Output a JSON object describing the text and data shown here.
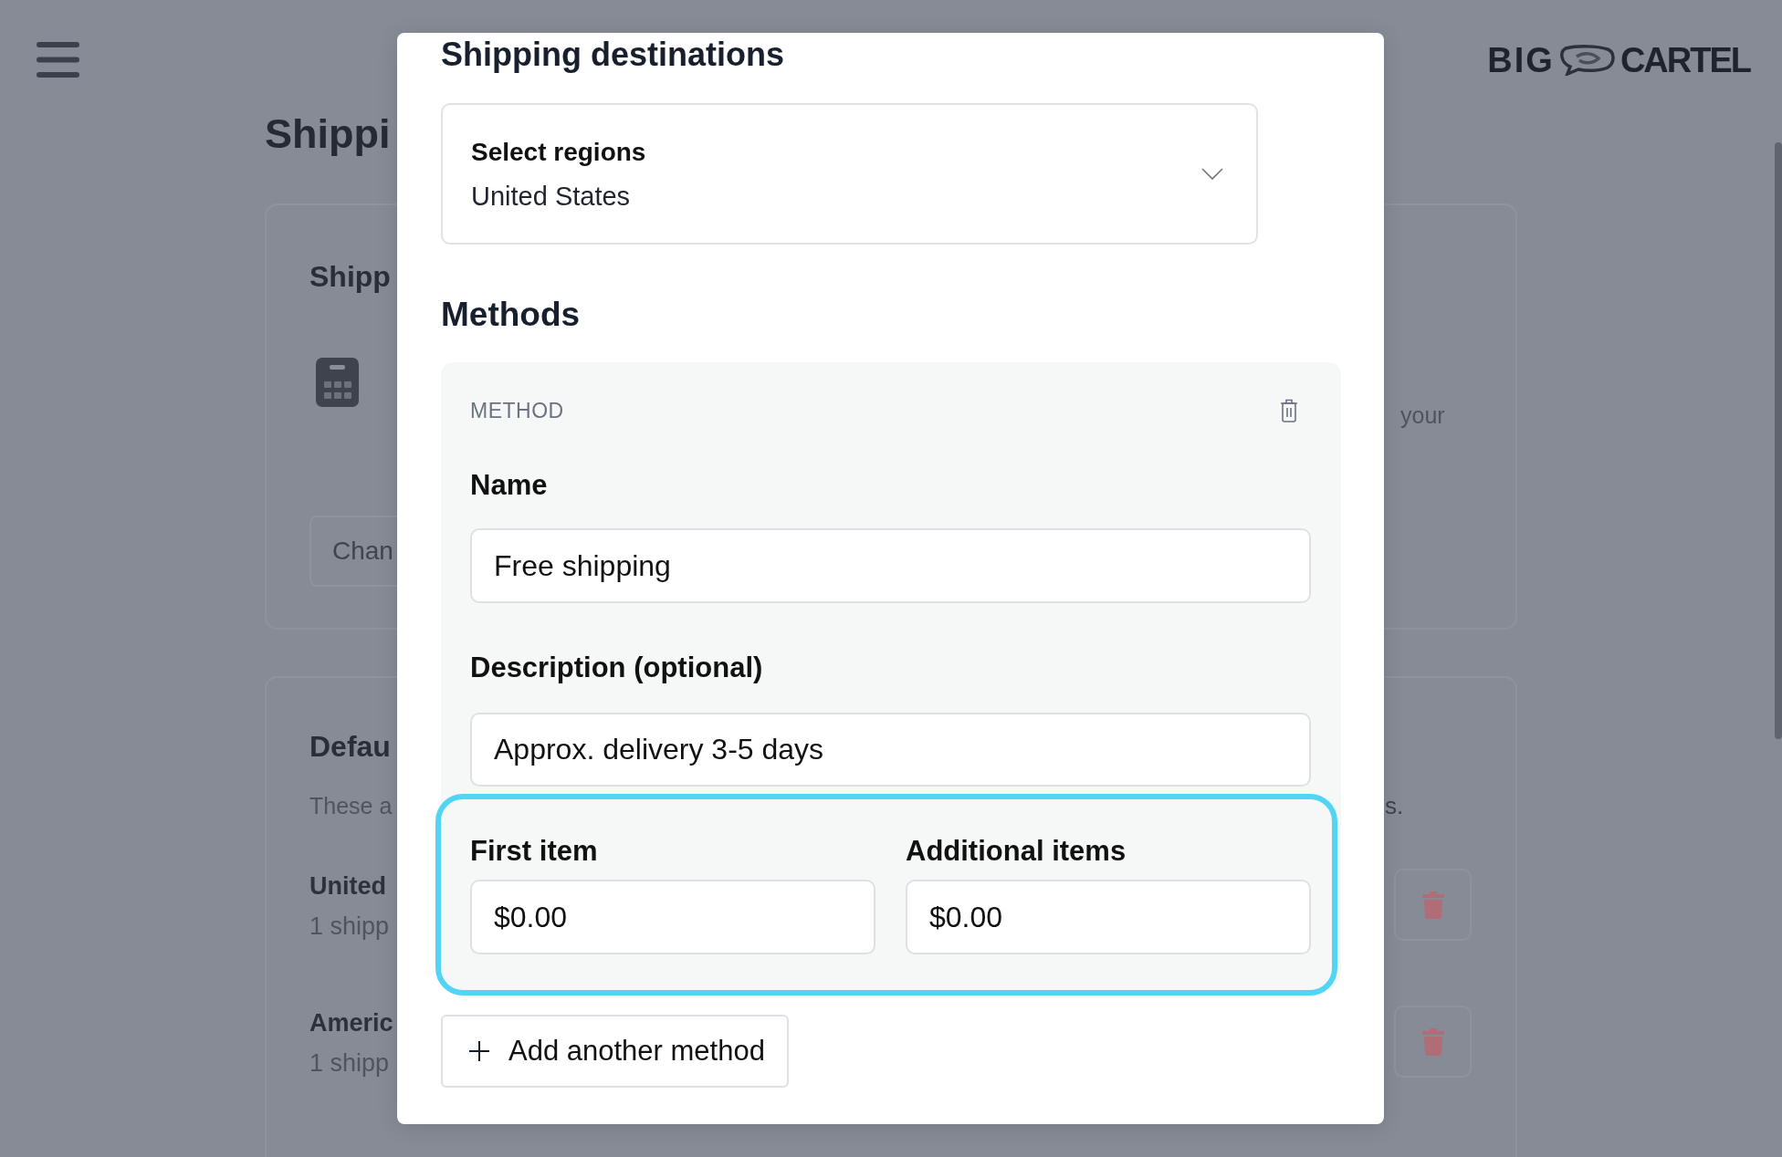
{
  "background_page": {
    "logo_words": [
      "BIG",
      "CARTEL"
    ],
    "title": "Shippi",
    "cards": [
      {
        "kind": "action",
        "title": "Shipp",
        "side_text": "your",
        "button": "Chan"
      },
      {
        "kind": "list",
        "title": "Defau",
        "description": "These a",
        "side_text": "s.",
        "rows": [
          {
            "name": "United",
            "detail": "1 shipp"
          },
          {
            "name": "Americ",
            "detail": "1 shipp"
          }
        ]
      }
    ]
  },
  "modal": {
    "destinations": {
      "heading": "Shipping destinations",
      "select": {
        "label": "Select regions",
        "value": "United States"
      }
    },
    "methods": {
      "heading": "Methods",
      "items": [
        {
          "tag": "METHOD",
          "fields": [
            {
              "label": "Name",
              "value": "Free shipping"
            },
            {
              "label": "Description (optional)",
              "value": "Approx. delivery 3-5 days"
            }
          ],
          "prices": {
            "highlighted": true,
            "fields": [
              {
                "label": "First item",
                "value": "$0.00"
              },
              {
                "label": "Additional items",
                "value": "$0.00"
              }
            ]
          }
        }
      ]
    },
    "add_button": "Add another method"
  }
}
